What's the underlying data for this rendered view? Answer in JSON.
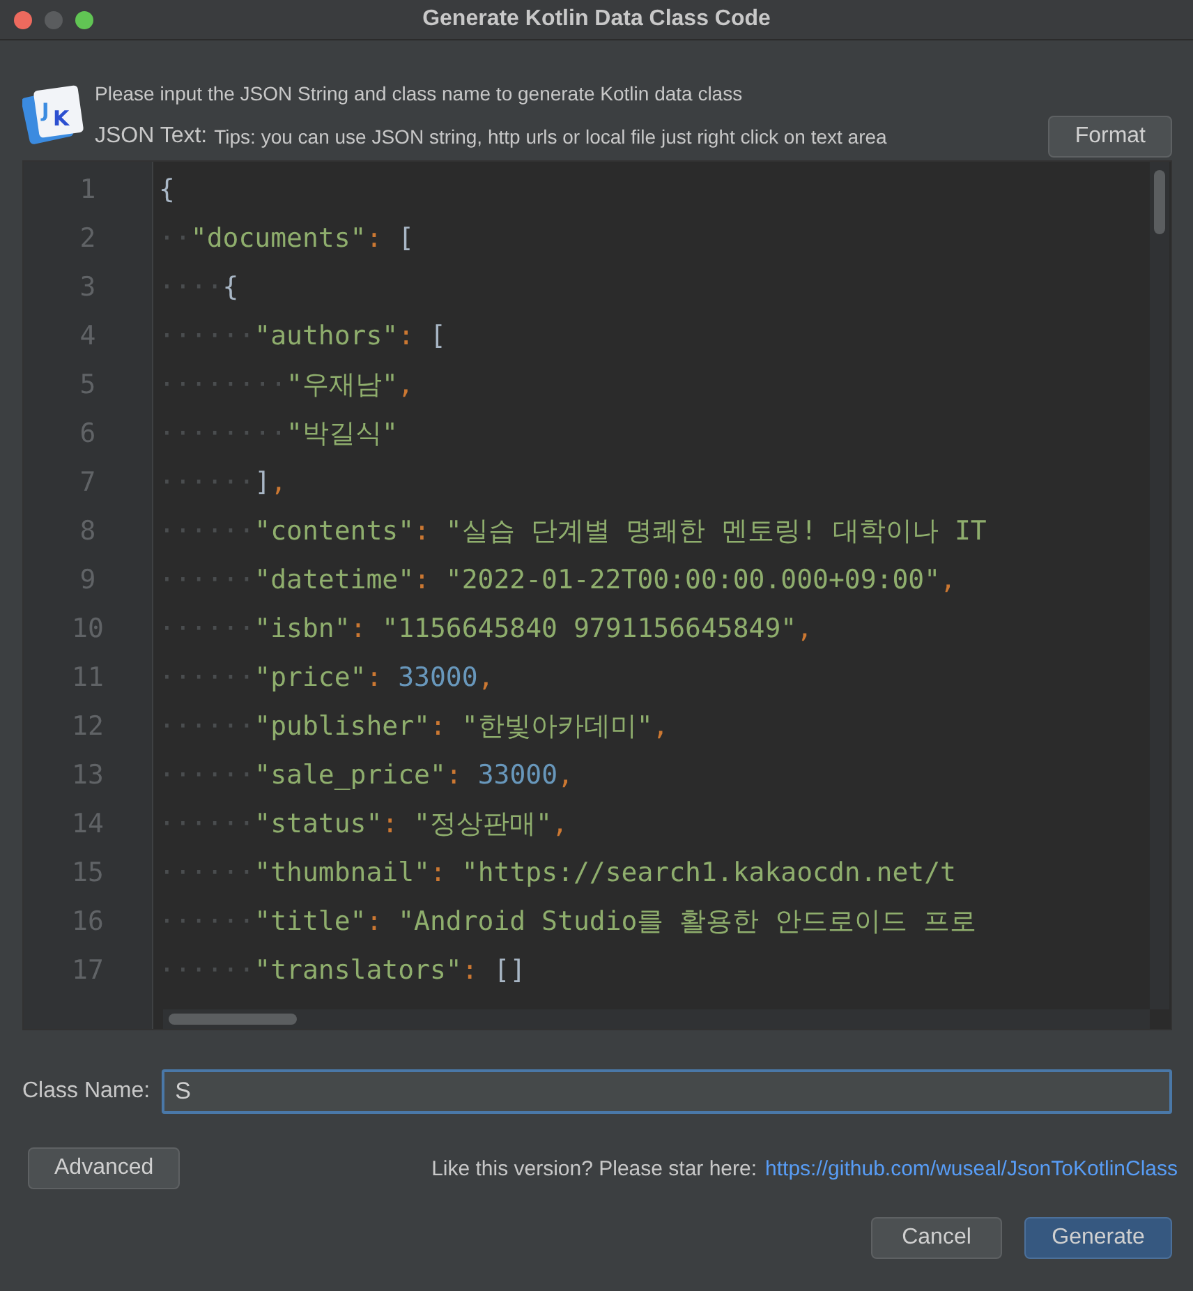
{
  "window": {
    "title": "Generate Kotlin Data Class Code",
    "controls": [
      {
        "color": "#ed6a5e"
      },
      {
        "color": "#5a5c5e"
      },
      {
        "color": "#61c554"
      }
    ]
  },
  "header": {
    "logo": "JK",
    "description": "Please input the JSON String and class name to generate Kotlin data class",
    "json_label": "JSON Text:",
    "tips": "Tips: you can use JSON string, http urls or local file just right click on text area",
    "format_button": "Format"
  },
  "editor": {
    "lines": [
      {
        "number": "1",
        "tokens": [
          {
            "kind": "bracket",
            "text": "{"
          }
        ]
      },
      {
        "number": "2",
        "indent": "··",
        "tokens": [
          {
            "kind": "string",
            "text": "\"documents\""
          },
          {
            "kind": "punct",
            "text": ": "
          },
          {
            "kind": "bracket",
            "text": "["
          }
        ]
      },
      {
        "number": "3",
        "indent": "····",
        "tokens": [
          {
            "kind": "bracket",
            "text": "{"
          }
        ]
      },
      {
        "number": "4",
        "indent": "······",
        "tokens": [
          {
            "kind": "string",
            "text": "\"authors\""
          },
          {
            "kind": "punct",
            "text": ": "
          },
          {
            "kind": "bracket",
            "text": "["
          }
        ]
      },
      {
        "number": "5",
        "indent": "········",
        "tokens": [
          {
            "kind": "string",
            "text": "\"우재남\""
          },
          {
            "kind": "punct",
            "text": ","
          }
        ]
      },
      {
        "number": "6",
        "indent": "········",
        "tokens": [
          {
            "kind": "string",
            "text": "\"박길식\""
          }
        ]
      },
      {
        "number": "7",
        "indent": "······",
        "tokens": [
          {
            "kind": "bracket",
            "text": "]"
          },
          {
            "kind": "punct",
            "text": ","
          }
        ]
      },
      {
        "number": "8",
        "indent": "······",
        "tokens": [
          {
            "kind": "string",
            "text": "\"contents\""
          },
          {
            "kind": "punct",
            "text": ": "
          },
          {
            "kind": "string",
            "text": "\"실습 단계별 명쾌한 멘토링! 대학이나 IT"
          }
        ]
      },
      {
        "number": "9",
        "indent": "······",
        "tokens": [
          {
            "kind": "string",
            "text": "\"datetime\""
          },
          {
            "kind": "punct",
            "text": ": "
          },
          {
            "kind": "string",
            "text": "\"2022-01-22T00:00:00.000+09:00\""
          },
          {
            "kind": "punct",
            "text": ","
          }
        ]
      },
      {
        "number": "10",
        "indent": "······",
        "tokens": [
          {
            "kind": "string",
            "text": "\"isbn\""
          },
          {
            "kind": "punct",
            "text": ": "
          },
          {
            "kind": "string",
            "text": "\"1156645840 9791156645849\""
          },
          {
            "kind": "punct",
            "text": ","
          }
        ]
      },
      {
        "number": "11",
        "indent": "······",
        "tokens": [
          {
            "kind": "string",
            "text": "\"price\""
          },
          {
            "kind": "punct",
            "text": ": "
          },
          {
            "kind": "number",
            "text": "33000"
          },
          {
            "kind": "punct",
            "text": ","
          }
        ]
      },
      {
        "number": "12",
        "indent": "······",
        "tokens": [
          {
            "kind": "string",
            "text": "\"publisher\""
          },
          {
            "kind": "punct",
            "text": ": "
          },
          {
            "kind": "string",
            "text": "\"한빛아카데미\""
          },
          {
            "kind": "punct",
            "text": ","
          }
        ]
      },
      {
        "number": "13",
        "indent": "······",
        "tokens": [
          {
            "kind": "string",
            "text": "\"sale_price\""
          },
          {
            "kind": "punct",
            "text": ": "
          },
          {
            "kind": "number",
            "text": "33000"
          },
          {
            "kind": "punct",
            "text": ","
          }
        ]
      },
      {
        "number": "14",
        "indent": "······",
        "tokens": [
          {
            "kind": "string",
            "text": "\"status\""
          },
          {
            "kind": "punct",
            "text": ": "
          },
          {
            "kind": "string",
            "text": "\"정상판매\""
          },
          {
            "kind": "punct",
            "text": ","
          }
        ]
      },
      {
        "number": "15",
        "indent": "······",
        "tokens": [
          {
            "kind": "string",
            "text": "\"thumbnail\""
          },
          {
            "kind": "punct",
            "text": ": "
          },
          {
            "kind": "string",
            "text": "\"https://search1.kakaocdn.net/t"
          }
        ]
      },
      {
        "number": "16",
        "indent": "······",
        "tokens": [
          {
            "kind": "string",
            "text": "\"title\""
          },
          {
            "kind": "punct",
            "text": ": "
          },
          {
            "kind": "string",
            "text": "\"Android Studio를 활용한 안드로이드 프로"
          }
        ]
      },
      {
        "number": "17",
        "indent": "······",
        "tokens": [
          {
            "kind": "string",
            "text": "\"translators\""
          },
          {
            "kind": "punct",
            "text": ": "
          },
          {
            "kind": "bracket",
            "text": "[]"
          }
        ]
      }
    ]
  },
  "class_name": {
    "label": "Class Name:",
    "value": "S",
    "focused": true
  },
  "footer": {
    "advanced_button": "Advanced",
    "star_text": "Like this version? Please star here:",
    "star_link": "https://github.com/wuseal/JsonToKotlinClass"
  },
  "buttons": [
    {
      "label": "Cancel",
      "default": false
    },
    {
      "label": "Generate",
      "default": true
    }
  ]
}
